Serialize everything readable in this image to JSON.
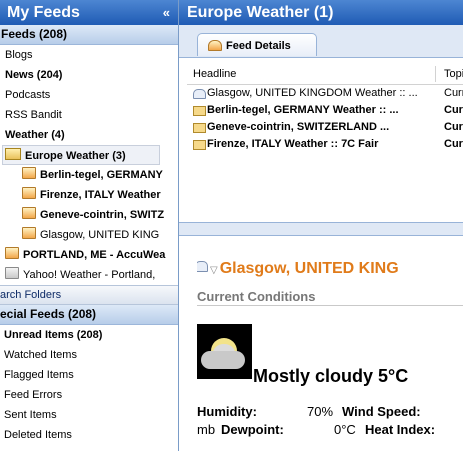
{
  "left": {
    "title": "My Feeds",
    "collapse_glyph": "«",
    "feeds_header": "Feeds  (208)",
    "items": [
      {
        "label": "Blogs",
        "bold": false
      },
      {
        "label": "News  (204)",
        "bold": true
      },
      {
        "label": "Podcasts",
        "bold": false
      },
      {
        "label": "RSS Bandit",
        "bold": false
      },
      {
        "label": "Weather  (4)",
        "bold": true
      }
    ],
    "selected_folder": "Europe Weather  (3)",
    "weather_feeds": [
      {
        "label": "Berlin-tegel, GERMANY",
        "bold": true
      },
      {
        "label": "Firenze, ITALY Weather",
        "bold": true
      },
      {
        "label": "Geneve-cointrin, SWITZ",
        "bold": true
      },
      {
        "label": "Glasgow, UNITED KING",
        "bold": false
      }
    ],
    "top_feeds": [
      {
        "label": "PORTLAND, ME - AccuWea",
        "bold": true
      },
      {
        "label": "Yahoo! Weather - Portland,",
        "bold": false
      }
    ],
    "search_folders": "arch Folders",
    "special_header": "ecial Feeds  (208)",
    "special_items": [
      {
        "label": "Unread Items  (208)",
        "bold": true
      },
      {
        "label": "Watched Items",
        "bold": false
      },
      {
        "label": "Flagged Items",
        "bold": false
      },
      {
        "label": "Feed Errors",
        "bold": false
      },
      {
        "label": "Sent Items",
        "bold": false
      },
      {
        "label": "Deleted Items",
        "bold": false
      }
    ]
  },
  "right": {
    "title": "Europe Weather (1)",
    "tab_label": "Feed Details",
    "columns": {
      "headline": "Headline",
      "topic": "Topi"
    },
    "rows": [
      {
        "headline": "Glasgow, UNITED KINGDOM Weather :: ...",
        "topic": "Curre",
        "bold": false,
        "icon": "read-envelope-icon"
      },
      {
        "headline": "Berlin-tegel, GERMANY Weather :: ...",
        "topic": "Curre",
        "bold": true,
        "icon": "unread-envelope-icon"
      },
      {
        "headline": "Geneve-cointrin, SWITZERLAND ...",
        "topic": "Curre",
        "bold": true,
        "icon": "unread-envelope-icon"
      },
      {
        "headline": "Firenze, ITALY Weather :: 7C Fair",
        "topic": "Curre",
        "bold": true,
        "icon": "unread-envelope-icon"
      }
    ],
    "reader": {
      "title": "Glasgow, UNITED KING",
      "subtitle": "Current Conditions",
      "condition": "Mostly cloudy 5°C",
      "humidity_label": "Humidity:",
      "humidity_value": "70%",
      "wind_label": "Wind Speed:",
      "dew_prefix": "mb",
      "dew_label": "Dewpoint:",
      "dew_value": "0°C",
      "heat_label": "Heat Index:"
    }
  },
  "colors": {
    "header_blue": "#2b68c3",
    "section_blue": "#c6d8ef",
    "title_orange": "#e07b1a"
  }
}
